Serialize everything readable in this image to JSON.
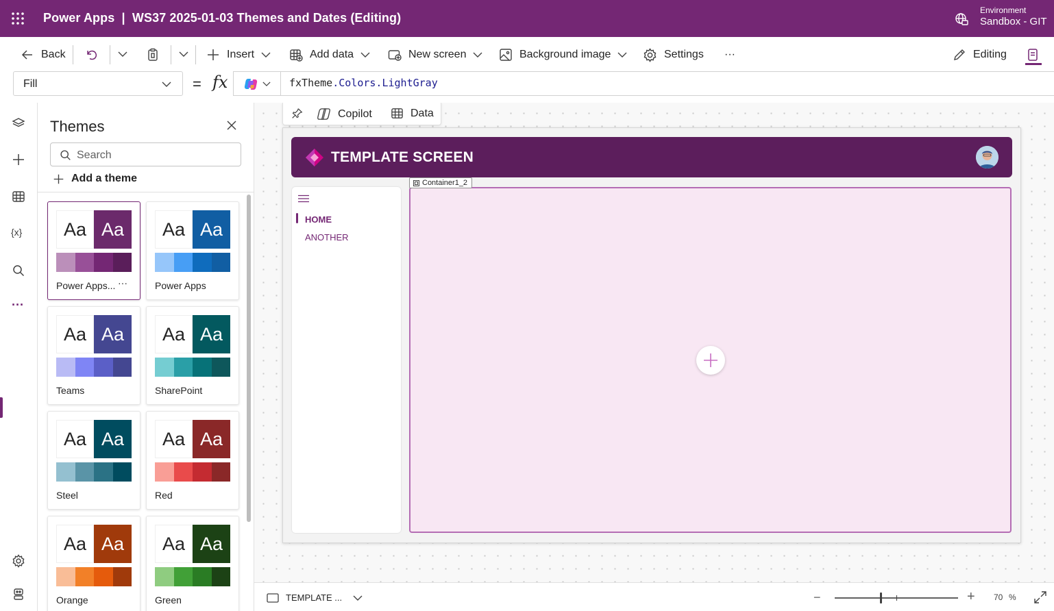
{
  "header": {
    "title": "Power Apps  |  WS37 2025-01-03 Themes and Dates (Editing)",
    "environment_label": "Environment",
    "environment_value": "Sandbox - GIT"
  },
  "commandbar": {
    "back": "Back",
    "insert": "Insert",
    "add_data": "Add data",
    "new_screen": "New screen",
    "background_image": "Background image",
    "settings": "Settings",
    "more": "···",
    "editing": "Editing"
  },
  "formula": {
    "property": "Fill",
    "equals": "=",
    "fx": "fx",
    "expression_prefix": "fxTheme",
    "expression_rest": ".Colors.LightGray"
  },
  "themes_panel": {
    "title": "Themes",
    "search_placeholder": "Search",
    "add_theme": "Add a theme",
    "sample_text": "Aa",
    "more": "···",
    "themes": [
      {
        "name": "Power Apps...",
        "selected": true,
        "primary": "#6b2a6b",
        "swatches": [
          "#bb8fba",
          "#985098",
          "#742774",
          "#5a1e5a"
        ]
      },
      {
        "name": "Power Apps",
        "selected": false,
        "primary": "#115ea3",
        "swatches": [
          "#96c6fa",
          "#479ef5",
          "#0f6cbd",
          "#115ea3"
        ]
      },
      {
        "name": "Teams",
        "selected": false,
        "primary": "#444791",
        "swatches": [
          "#b9bbf5",
          "#7f85f5",
          "#5b5fc7",
          "#444791"
        ]
      },
      {
        "name": "SharePoint",
        "selected": false,
        "primary": "#03595f",
        "swatches": [
          "#75cdd2",
          "#2a9fa7",
          "#077278",
          "#0e575b"
        ]
      },
      {
        "name": "Steel",
        "selected": false,
        "primary": "#004c5f",
        "swatches": [
          "#94c0d0",
          "#5a94a7",
          "#2b7285",
          "#004c5f"
        ]
      },
      {
        "name": "Red",
        "selected": false,
        "primary": "#8a2828",
        "swatches": [
          "#f99e96",
          "#e94b4b",
          "#c42b31",
          "#8a2828"
        ]
      },
      {
        "name": "Orange",
        "selected": false,
        "primary": "#a03a0b",
        "swatches": [
          "#f9bd97",
          "#f28028",
          "#e55b0c",
          "#a03a0b"
        ]
      },
      {
        "name": "Green",
        "selected": false,
        "primary": "#1c4215",
        "swatches": [
          "#8fcc80",
          "#41a037",
          "#2a7c24",
          "#1c4215"
        ]
      }
    ]
  },
  "canvas": {
    "toolbar": {
      "copilot": "Copilot",
      "data": "Data"
    },
    "screen_title": "TEMPLATE SCREEN",
    "nav_items": [
      "HOME",
      "ANOTHER"
    ],
    "container_label": "Container1_2"
  },
  "statusbar": {
    "screen_name": "TEMPLATE ...",
    "zoom_minus": "−",
    "zoom_plus": "+",
    "zoom_value": "70",
    "zoom_unit": "%",
    "zoom_level": 0.37
  },
  "colors": {
    "brand": "#742774",
    "header_bar": "#5c1e5c",
    "container_fill": "#f8e7f3"
  }
}
